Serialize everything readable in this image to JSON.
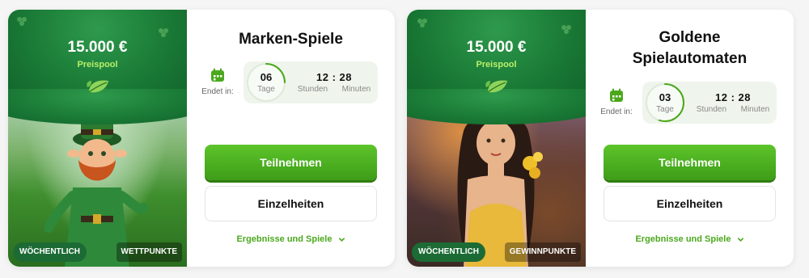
{
  "colors": {
    "accent_green": "#4ba81d",
    "button_green": "#4cae1f",
    "banner_green": "#1a7a36",
    "timer_bg": "#eff5ec"
  },
  "icons": {
    "calendar": "calendar-icon",
    "leaf": "leaf-icon",
    "chevron": "chevron-down-icon"
  },
  "tournaments": [
    {
      "prize_pool": "15.000 €",
      "prize_pool_label": "Preispool",
      "badge_frequency": "WÖCHENTLICH",
      "badge_type": "WETTPUNKTE",
      "title_lines": [
        "Marken-Spiele"
      ],
      "ends_label": "Endet in:",
      "days_value": "06",
      "days_label": "Tage",
      "days_progress_fraction": 0.25,
      "time_value": "12 : 28",
      "hours_label": "Stunden",
      "minutes_label": "Minuten",
      "join_label": "Teilnehmen",
      "details_label": "Einzelheiten",
      "results_link": "Ergebnisse und Spiele"
    },
    {
      "prize_pool": "15.000 €",
      "prize_pool_label": "Preispool",
      "badge_frequency": "WÖCHENTLICH",
      "badge_type": "GEWINNPUNKTE",
      "title_lines": [
        "Goldene",
        "Spielautomaten"
      ],
      "ends_label": "Endet in:",
      "days_value": "03",
      "days_label": "Tage",
      "days_progress_fraction": 0.55,
      "time_value": "12 : 28",
      "hours_label": "Stunden",
      "minutes_label": "Minuten",
      "join_label": "Teilnehmen",
      "details_label": "Einzelheiten",
      "results_link": "Ergebnisse und Spiele"
    }
  ]
}
